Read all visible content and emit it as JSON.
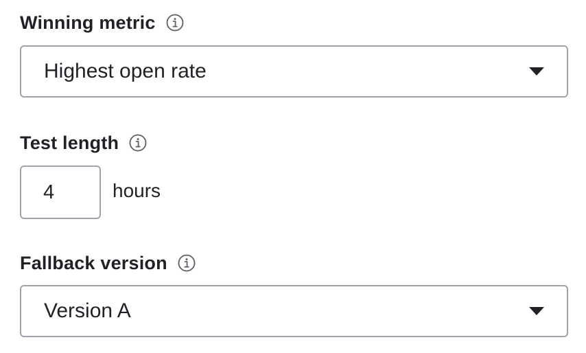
{
  "winning_metric": {
    "label": "Winning metric",
    "info_icon": "info-icon",
    "selected_value": "Highest open rate",
    "dropdown_icon": "caret-down-icon"
  },
  "test_length": {
    "label": "Test length",
    "info_icon": "info-icon",
    "value": "4",
    "unit": "hours"
  },
  "fallback_version": {
    "label": "Fallback version",
    "info_icon": "info-icon",
    "selected_value": "Version A",
    "dropdown_icon": "caret-down-icon"
  },
  "colors": {
    "text": "#1f2126",
    "border": "#9da3ab",
    "icon": "#5b6068"
  }
}
